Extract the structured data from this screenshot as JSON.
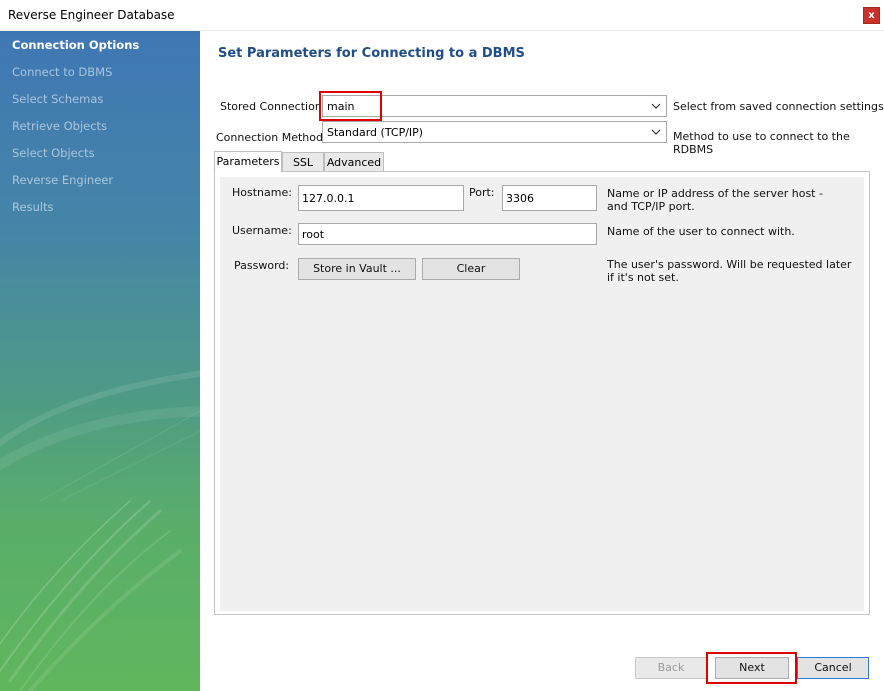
{
  "window": {
    "title": "Reverse Engineer Database",
    "close_label": "x"
  },
  "sidebar": {
    "items": [
      {
        "label": "Connection Options"
      },
      {
        "label": "Connect to DBMS"
      },
      {
        "label": "Select Schemas"
      },
      {
        "label": "Retrieve Objects"
      },
      {
        "label": "Select Objects"
      },
      {
        "label": "Reverse Engineer"
      },
      {
        "label": "Results"
      }
    ],
    "active_index": 0
  },
  "main": {
    "heading": "Set Parameters for Connecting to a DBMS",
    "stored_connection": {
      "label": "Stored Connection:",
      "value": "main",
      "help": "Select from saved connection settings"
    },
    "connection_method": {
      "label": "Connection Method:",
      "value": "Standard (TCP/IP)",
      "help": "Method to use to connect to the RDBMS"
    },
    "tabs": [
      {
        "label": "Parameters"
      },
      {
        "label": "SSL"
      },
      {
        "label": "Advanced"
      }
    ],
    "active_tab": "Parameters",
    "parameters": {
      "hostname": {
        "label": "Hostname:",
        "value": "127.0.0.1"
      },
      "port": {
        "label": "Port:",
        "value": "3306"
      },
      "host_help": "Name or IP address of the server host - and TCP/IP port.",
      "username": {
        "label": "Username:",
        "value": "root",
        "help": "Name of the user to connect with."
      },
      "password": {
        "label": "Password:",
        "store_button": "Store in Vault ...",
        "clear_button": "Clear",
        "help": "The user's password. Will be requested later if it's not set."
      }
    }
  },
  "footer": {
    "back": "Back",
    "next": "Next",
    "cancel": "Cancel"
  },
  "colors": {
    "heading": "#1f4d87",
    "highlight": "#e00000",
    "close": "#c9312a",
    "cancel_border": "#2f7bd6"
  }
}
